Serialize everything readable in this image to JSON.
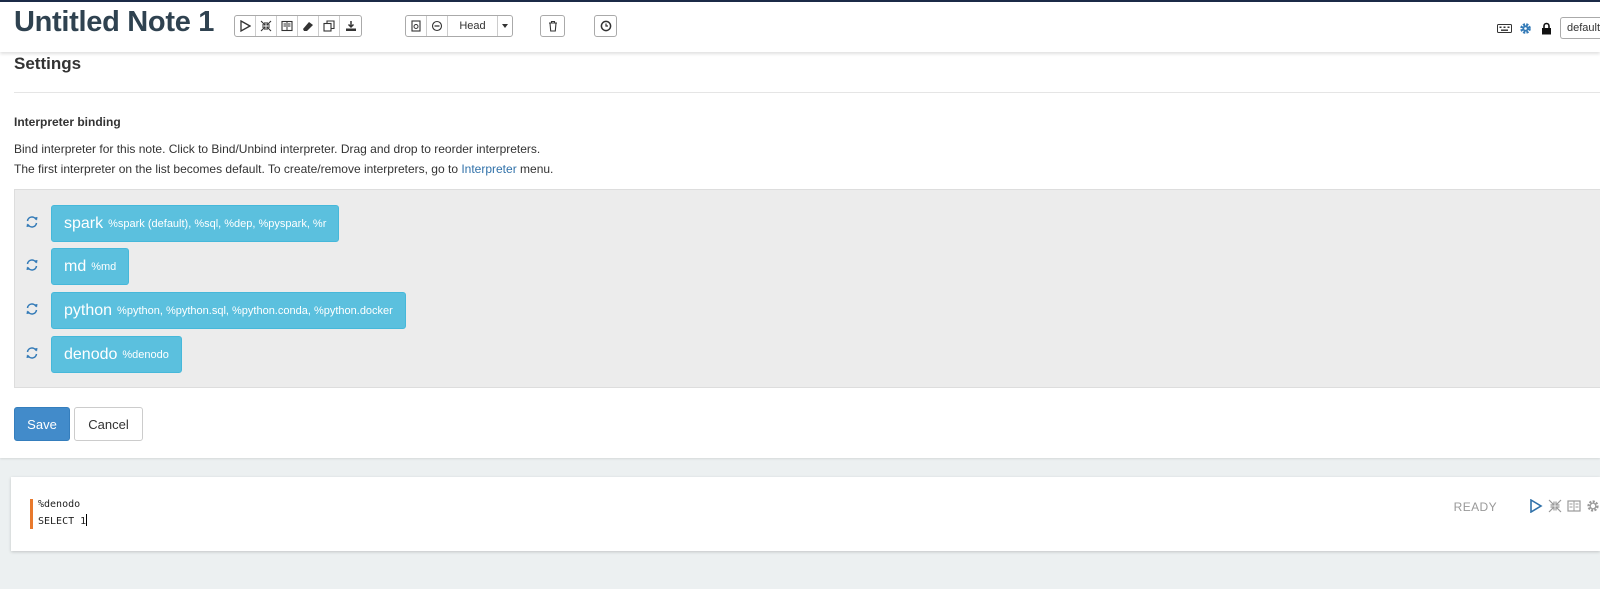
{
  "header": {
    "note_title": "Untitled Note 1",
    "run_icons": [
      "play-icon",
      "collapse-icon",
      "book-icon",
      "eraser-icon",
      "clone-icon",
      "download-icon"
    ],
    "version_icons": [
      "commit-icon",
      "revert-icon"
    ],
    "revision_select": "Head",
    "trash_icon": "trash-icon",
    "schedule_icon": "clock-icon",
    "right_icons": [
      "keyboard-icon",
      "gear-icon",
      "lock-icon"
    ],
    "interpreter_default": "default"
  },
  "settings": {
    "title": "Settings",
    "binding_title": "Interpreter binding",
    "description_line1": "Bind interpreter for this note. Click to Bind/Unbind interpreter. Drag and drop to reorder interpreters.",
    "description_line2_before": "The first interpreter on the list becomes default. To create/remove interpreters, go to ",
    "description_link": "Interpreter",
    "description_line2_after": " menu.",
    "interpreters": [
      {
        "name": "spark",
        "aliases": "%spark (default), %sql, %dep, %pyspark, %r"
      },
      {
        "name": "md",
        "aliases": "%md"
      },
      {
        "name": "python",
        "aliases": "%python, %python.sql, %python.conda, %python.docker"
      },
      {
        "name": "denodo",
        "aliases": "%denodo"
      }
    ],
    "save_label": "Save",
    "cancel_label": "Cancel"
  },
  "paragraph": {
    "code_lines": [
      "%denodo",
      "SELECT 1"
    ],
    "status": "READY",
    "tool_icons": [
      "play-icon",
      "collapse-icon",
      "book-icon",
      "gear-icon"
    ]
  },
  "colors": {
    "interpreter_button": "#5bc0de",
    "save_button": "#428bca",
    "editor_bar": "#e8792d",
    "title_text": "#2f4250",
    "link": "#3071a9"
  }
}
